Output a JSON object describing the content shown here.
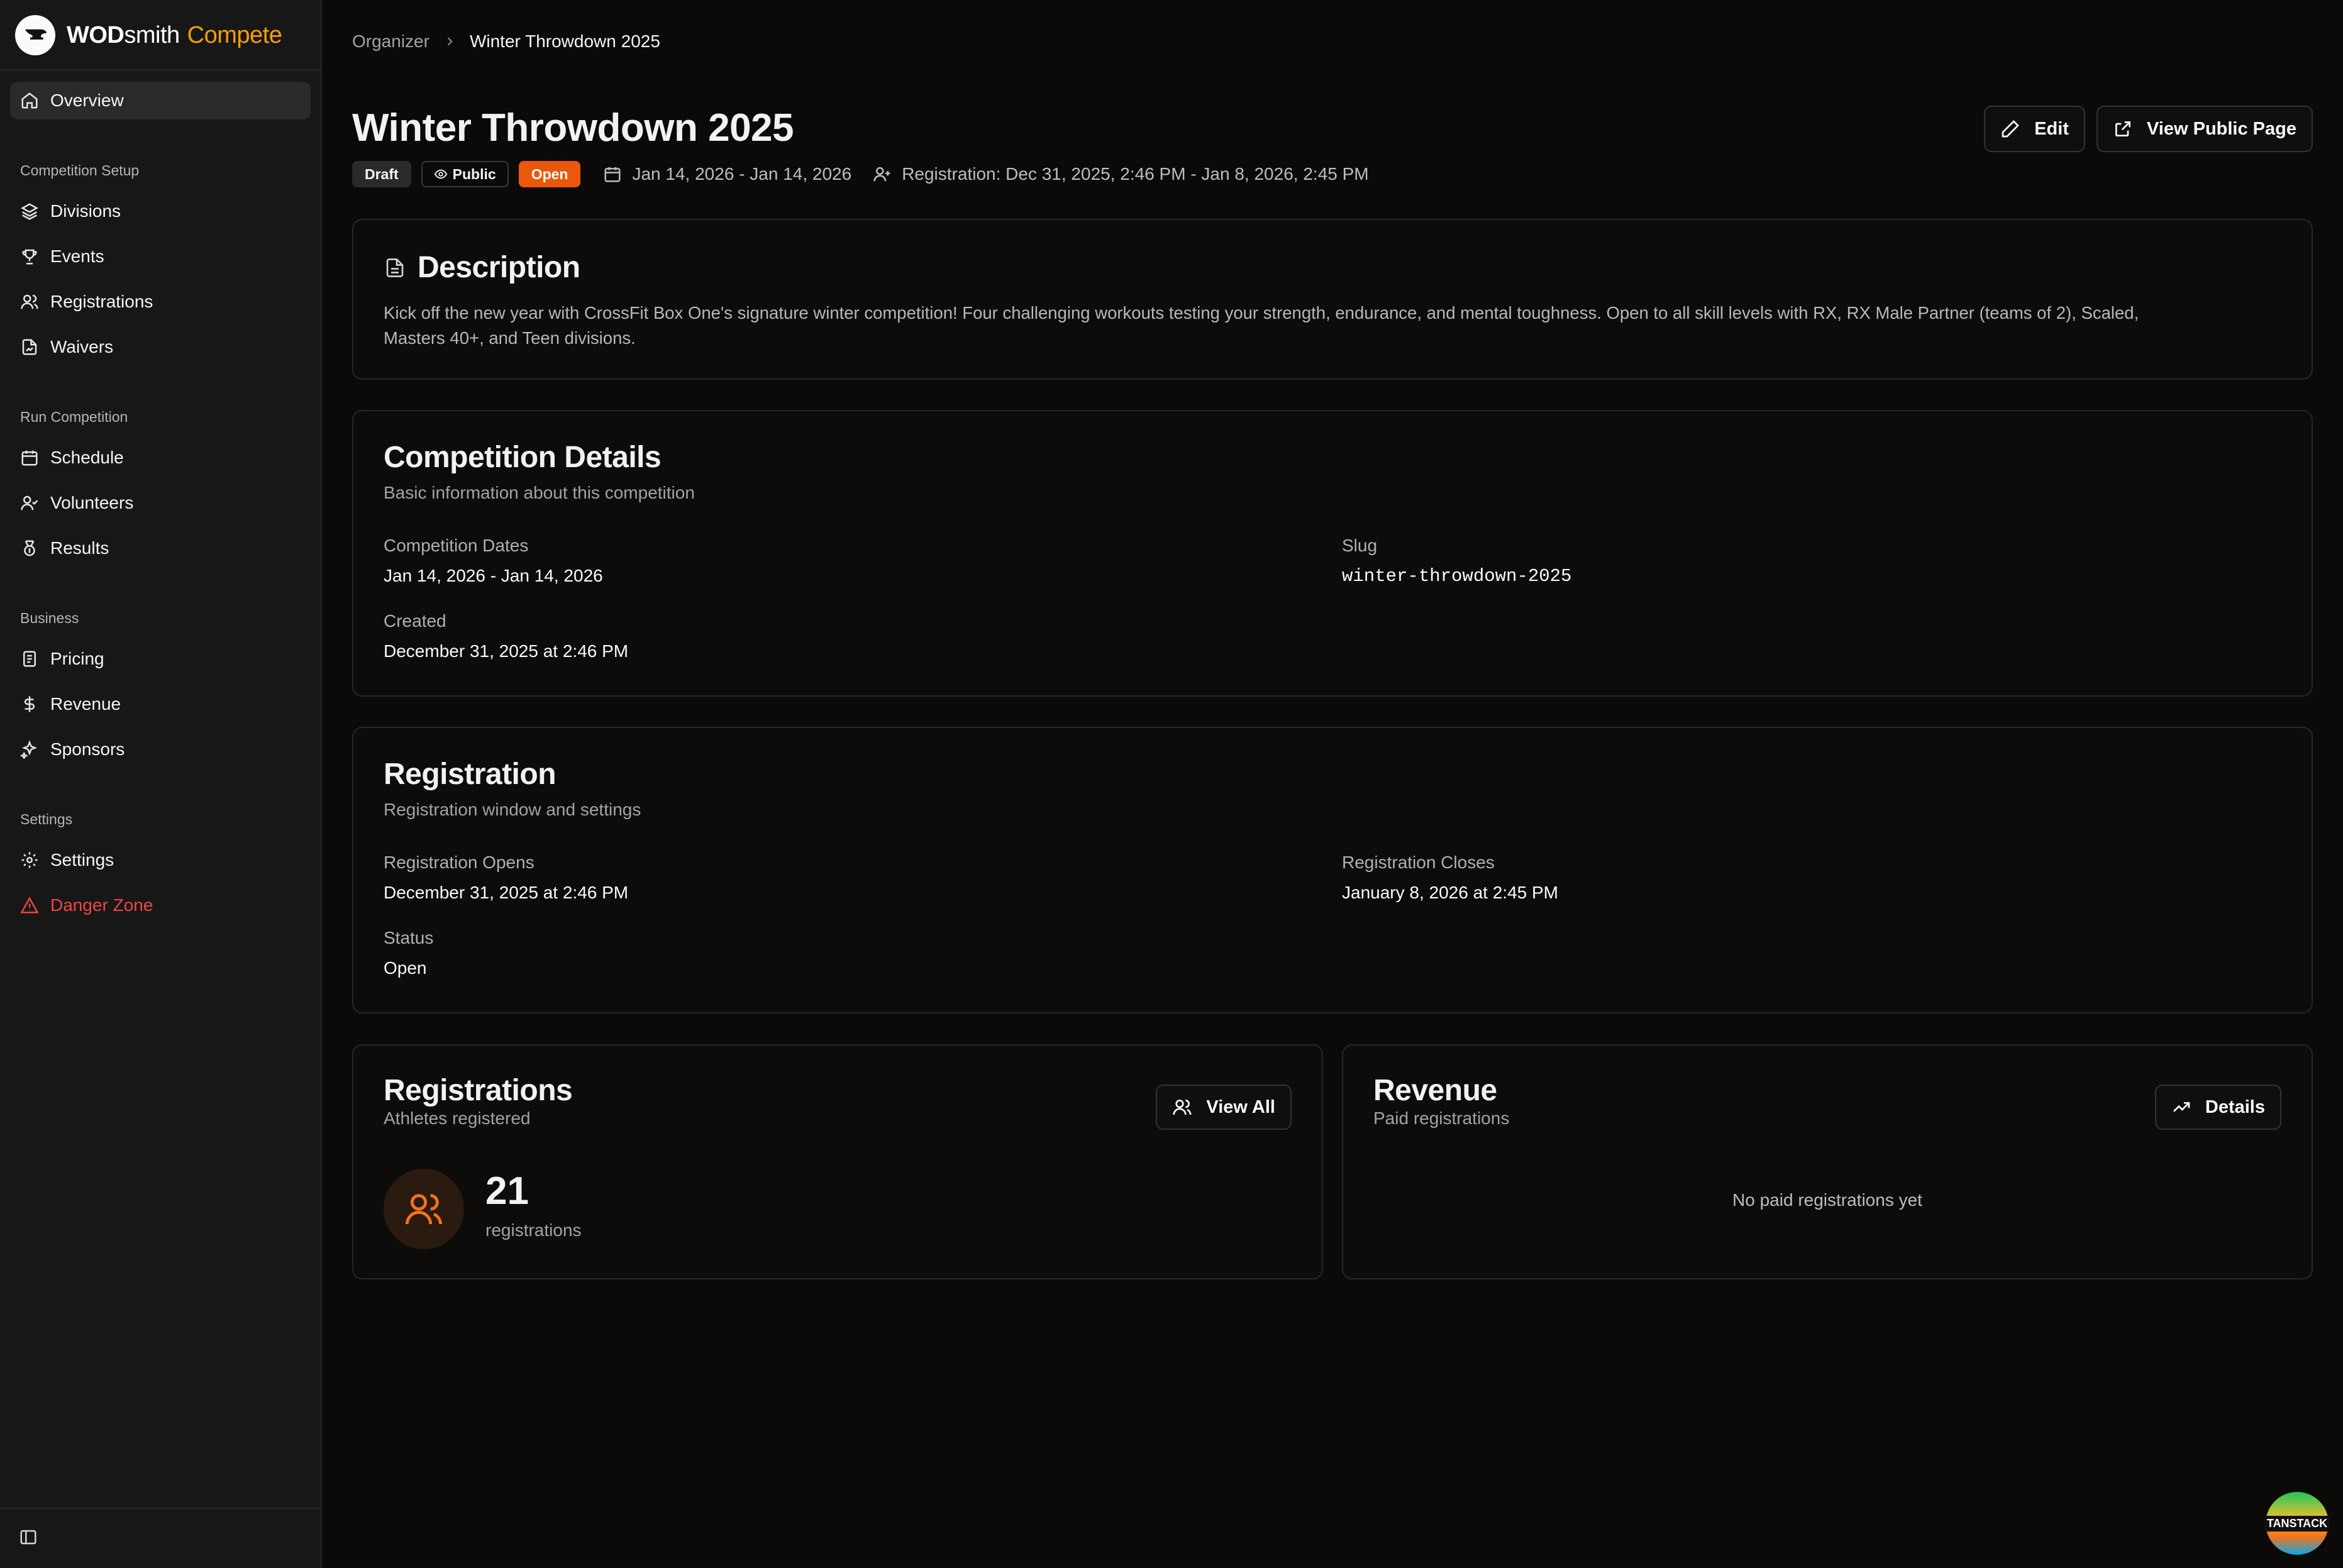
{
  "brand": {
    "name_bold": "WOD",
    "name_rest": "smith",
    "product": "Compete",
    "accent": "#f59e0b"
  },
  "sidebar": {
    "overview": {
      "label": "Overview",
      "icon": "home-icon"
    },
    "groups": [
      {
        "label": "Competition Setup",
        "items": [
          {
            "label": "Divisions",
            "icon": "layers-icon"
          },
          {
            "label": "Events",
            "icon": "trophy-icon"
          },
          {
            "label": "Registrations",
            "icon": "users-icon"
          },
          {
            "label": "Waivers",
            "icon": "file-signature-icon"
          }
        ]
      },
      {
        "label": "Run Competition",
        "items": [
          {
            "label": "Schedule",
            "icon": "calendar-icon"
          },
          {
            "label": "Volunteers",
            "icon": "user-check-icon"
          },
          {
            "label": "Results",
            "icon": "medal-icon"
          }
        ]
      },
      {
        "label": "Business",
        "items": [
          {
            "label": "Pricing",
            "icon": "receipt-icon"
          },
          {
            "label": "Revenue",
            "icon": "dollar-icon"
          },
          {
            "label": "Sponsors",
            "icon": "sparkles-icon"
          }
        ]
      },
      {
        "label": "Settings",
        "items": [
          {
            "label": "Settings",
            "icon": "gear-icon"
          },
          {
            "label": "Danger Zone",
            "icon": "alert-triangle-icon",
            "color": "#ef4444"
          }
        ]
      }
    ]
  },
  "breadcrumb": {
    "parent": "Organizer",
    "current": "Winter Throwdown 2025"
  },
  "header": {
    "title": "Winter Throwdown 2025",
    "badges": {
      "draft": "Draft",
      "public": "Public",
      "open": "Open"
    },
    "dates": "Jan 14, 2026 - Jan 14, 2026",
    "registration_window": "Registration: Dec 31, 2025, 2:46 PM - Jan 8, 2026, 2:45 PM",
    "edit_label": "Edit",
    "view_public_label": "View Public Page"
  },
  "description": {
    "title": "Description",
    "text_line1": "Kick off the new year with CrossFit Box One's signature winter competition! Four challenging workouts testing your strength, endurance, and mental toughness. Open to all skill levels with RX, RX Male Partner (teams of 2), Scaled,",
    "text_line2": "Masters 40+, and Teen divisions."
  },
  "details": {
    "title": "Competition Details",
    "subtitle": "Basic information about this competition",
    "dates_label": "Competition Dates",
    "dates_value": "Jan 14, 2026 - Jan 14, 2026",
    "slug_label": "Slug",
    "slug_value": "winter-throwdown-2025",
    "created_label": "Created",
    "created_value": "December 31, 2025 at 2:46 PM"
  },
  "registration": {
    "title": "Registration",
    "subtitle": "Registration window and settings",
    "opens_label": "Registration Opens",
    "opens_value": "December 31, 2025 at 2:46 PM",
    "closes_label": "Registration Closes",
    "closes_value": "January 8, 2026 at 2:45 PM",
    "status_label": "Status",
    "status_value": "Open"
  },
  "registrations_card": {
    "title": "Registrations",
    "subtitle": "Athletes registered",
    "button_label": "View All",
    "count": "21",
    "count_label": "registrations"
  },
  "revenue_card": {
    "title": "Revenue",
    "subtitle": "Paid registrations",
    "button_label": "Details",
    "empty_text": "No paid registrations yet"
  },
  "devtools": {
    "label": "TANSTACK"
  }
}
